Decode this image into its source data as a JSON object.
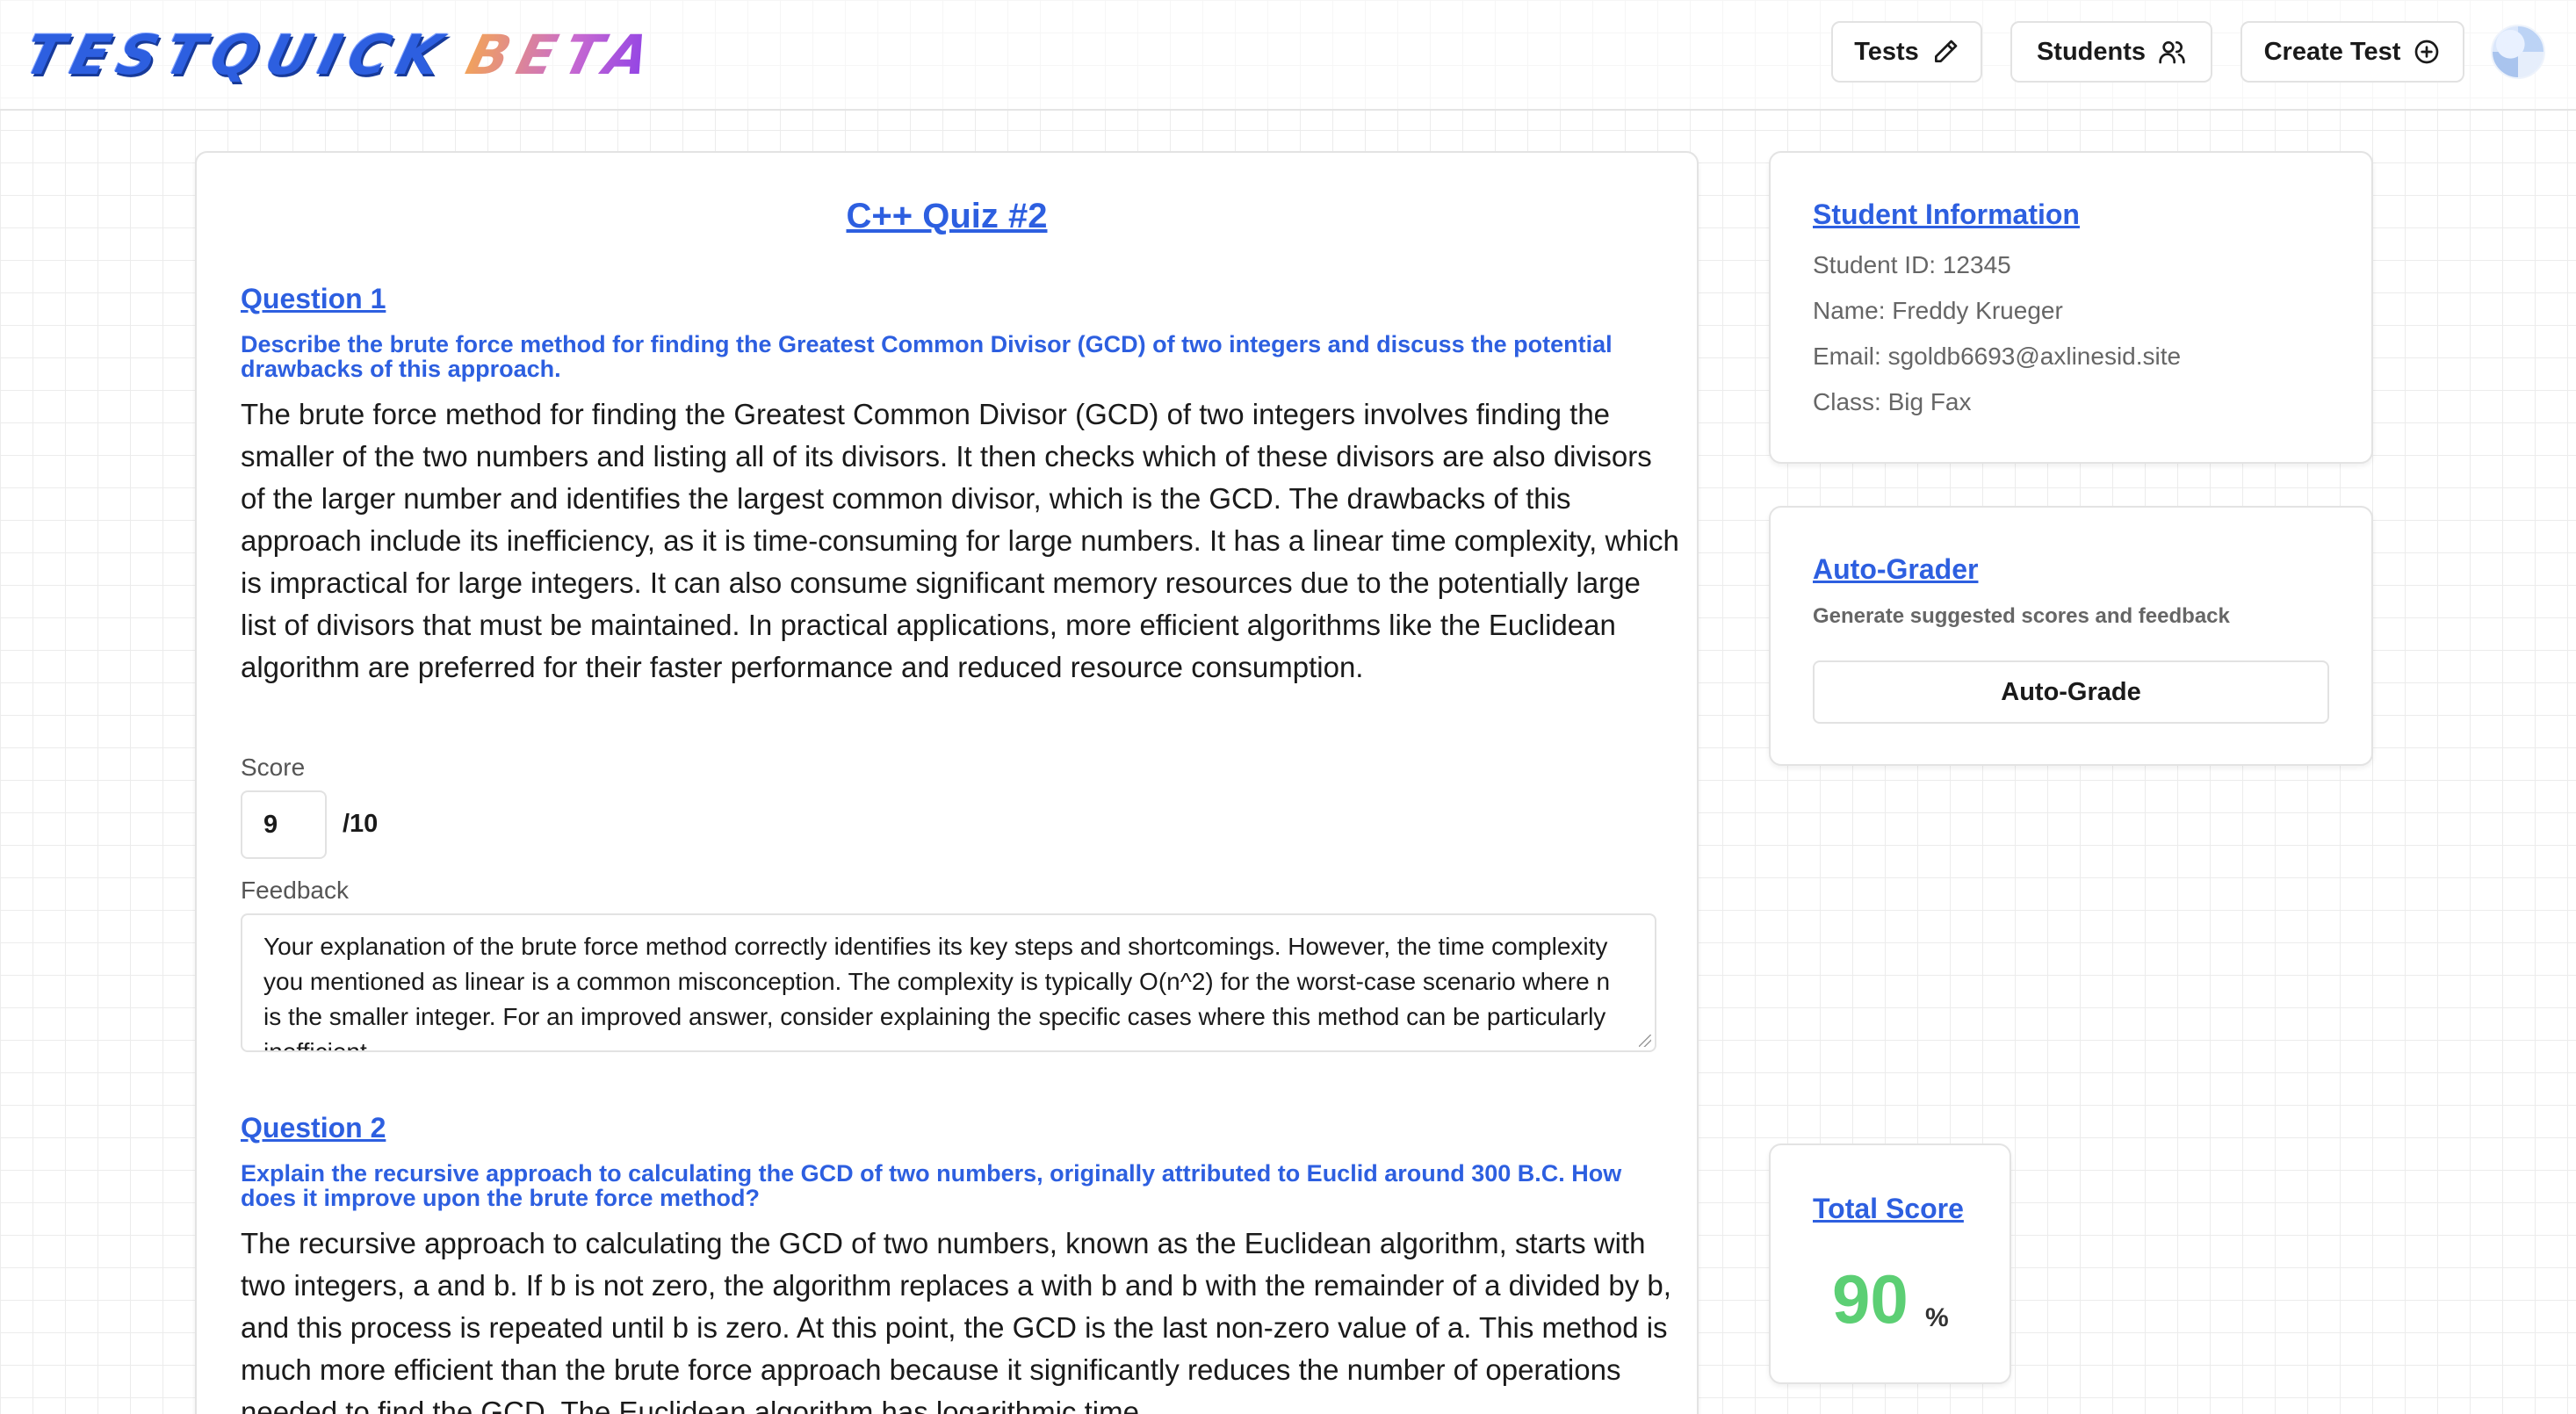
{
  "header": {
    "logo_word1": "TESTQUICK",
    "logo_word2": "BETA",
    "nav": {
      "tests_label": "Tests",
      "students_label": "Students",
      "create_label": "Create Test"
    }
  },
  "quiz": {
    "title": "C++ Quiz #2",
    "questions": [
      {
        "heading": "Question 1",
        "prompt": "Describe the brute force method for finding the Greatest Common Divisor (GCD) of two integers and discuss the potential drawbacks of this approach.",
        "answer": "The brute force method for finding the Greatest Common Divisor (GCD) of two integers involves finding the smaller of the two numbers and listing all of its divisors. It then checks which of these divisors are also divisors of the larger number and identifies the largest common divisor, which is the GCD. The drawbacks of this approach include its inefficiency, as it is time-consuming for large numbers. It has a linear time complexity, which is impractical for large integers. It can also consume significant memory resources due to the potentially large list of divisors that must be maintained. In practical applications, more efficient algorithms like the Euclidean algorithm are preferred for their faster performance and reduced resource consumption.",
        "score_label": "Score",
        "score": "9",
        "max": "/10",
        "feedback_label": "Feedback",
        "feedback": "Your explanation of the brute force method correctly identifies its key steps and shortcomings. However, the time complexity you mentioned as linear is a common misconception. The complexity is typically O(n^2) for the worst-case scenario where n is the smaller integer. For an improved answer, consider explaining the specific cases where this method can be particularly inefficient."
      },
      {
        "heading": "Question 2",
        "prompt": "Explain the recursive approach to calculating the GCD of two numbers, originally attributed to Euclid around 300 B.C. How does it improve upon the brute force method?",
        "answer": "The recursive approach to calculating the GCD of two numbers, known as the Euclidean algorithm, starts with two integers, a and b. If b is not zero, the algorithm replaces a with b and b with the remainder of a divided by b, and this process is repeated until b is zero. At this point, the GCD is the last non-zero value of a. This method is much more efficient than the brute force approach because it significantly reduces the number of operations needed to find the GCD. The Euclidean algorithm has logarithmic time"
      }
    ]
  },
  "student": {
    "title": "Student Information",
    "id": "Student ID: 12345",
    "name": "Name: Freddy Krueger",
    "email": "Email: sgoldb6693@axlinesid.site",
    "class": "Class: Big Fax"
  },
  "autograder": {
    "title": "Auto-Grader",
    "subtitle": "Generate suggested scores and feedback",
    "button_label": "Auto-Grade"
  },
  "total": {
    "title": "Total Score",
    "value": "90",
    "unit": "%"
  },
  "colors": {
    "accent": "#2d5fe0",
    "score_green": "#5ccf74"
  }
}
